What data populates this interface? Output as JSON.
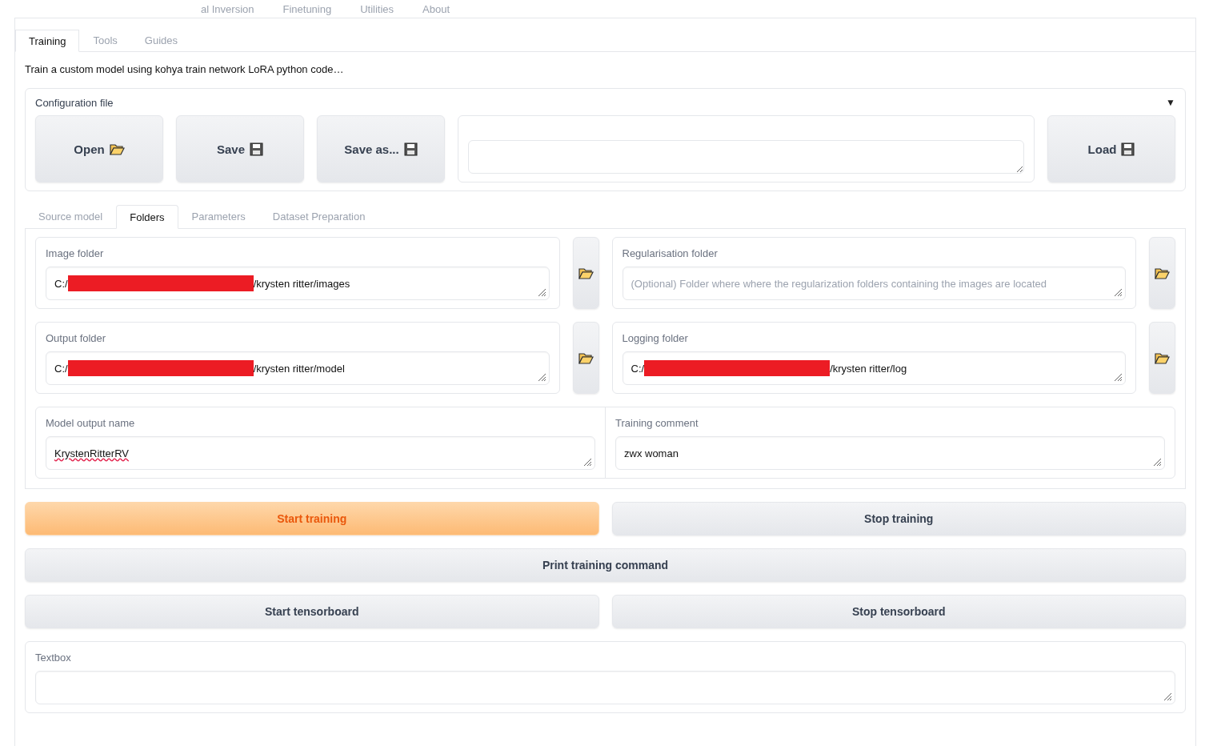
{
  "top_tabs": [
    {
      "label": "al Inversion",
      "selected": false
    },
    {
      "label": "Finetuning",
      "selected": false
    },
    {
      "label": "Utilities",
      "selected": false
    },
    {
      "label": "About",
      "selected": false
    }
  ],
  "sub_tabs": [
    {
      "label": "Training",
      "selected": true
    },
    {
      "label": "Tools",
      "selected": false
    },
    {
      "label": "Guides",
      "selected": false
    }
  ],
  "description": "Train a custom model using kohya train network LoRA python code…",
  "config": {
    "title": "Configuration file",
    "toggle": "▼",
    "buttons": [
      {
        "label": "Open",
        "kind": "folder"
      },
      {
        "label": "Save",
        "kind": "floppy"
      },
      {
        "label": "Save as...",
        "kind": "floppy"
      }
    ],
    "load": {
      "label": "Load",
      "kind": "floppy"
    }
  },
  "section_tabs": [
    {
      "label": "Source model",
      "selected": false
    },
    {
      "label": "Folders",
      "selected": true
    },
    {
      "label": "Parameters",
      "selected": false
    },
    {
      "label": "Dataset Preparation",
      "selected": false
    }
  ],
  "folders": [
    {
      "label": "Image folder",
      "prefix": "C:/",
      "redacted": true,
      "suffix": "/krysten ritter/images"
    },
    {
      "label": "Regularisation folder",
      "placeholder": "(Optional) Folder where where the regularization folders containing the images are located"
    },
    {
      "label": "Output folder",
      "prefix": "C:/",
      "redacted": true,
      "suffix": "/krysten ritter/model"
    },
    {
      "label": "Logging folder",
      "prefix": "C:/",
      "redacted": true,
      "suffix": "/krysten ritter/log"
    }
  ],
  "name_fields": [
    {
      "label": "Model output name",
      "value": "KrystenRitterRV",
      "misspelled": true
    },
    {
      "label": "Training comment",
      "value": "zwx woman",
      "misspelled": false
    }
  ],
  "action_rows": [
    [
      {
        "label": "Start training",
        "kind": "primary"
      },
      {
        "label": "Stop training",
        "kind": "secondary"
      }
    ],
    [
      {
        "label": "Print training command",
        "kind": "secondary"
      }
    ],
    [
      {
        "label": "Start tensorboard",
        "kind": "secondary"
      },
      {
        "label": "Stop tensorboard",
        "kind": "secondary"
      }
    ]
  ],
  "textbox": {
    "label": "Textbox"
  }
}
